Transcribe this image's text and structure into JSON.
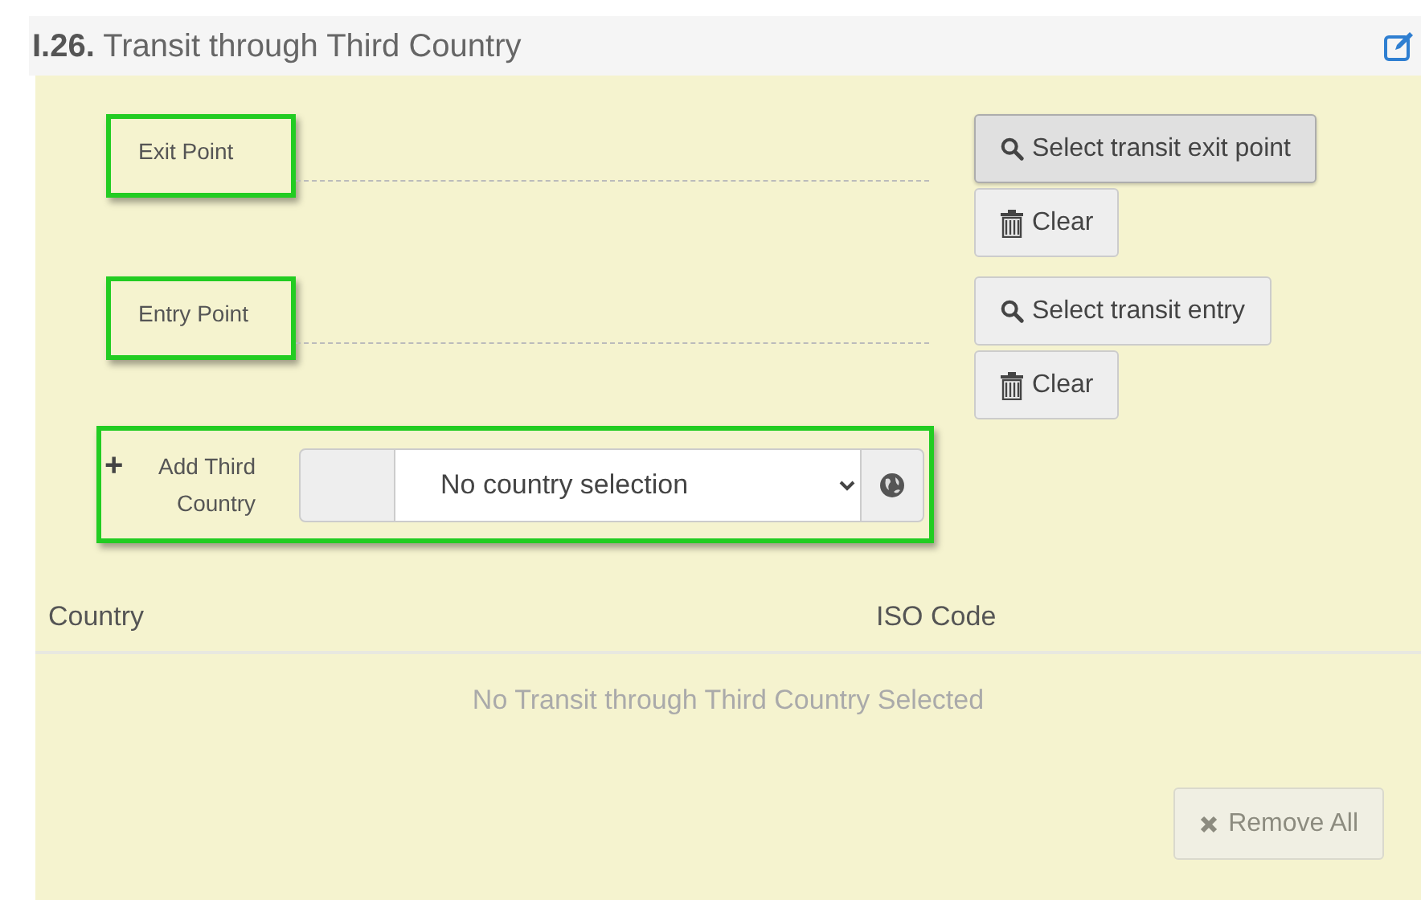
{
  "section": {
    "number": "I.26.",
    "title": "Transit through Third Country"
  },
  "points": [
    {
      "label": "Exit Point",
      "highlighted": true,
      "buttons": [
        {
          "kind": "search",
          "label": "Select transit exit point",
          "hovered": true
        },
        {
          "kind": "clear",
          "label": "Clear",
          "hovered": false
        }
      ]
    },
    {
      "label": "Entry Point",
      "highlighted": true,
      "buttons": [
        {
          "kind": "search",
          "label": "Select transit entry",
          "hovered": false
        },
        {
          "kind": "clear",
          "label": "Clear",
          "hovered": false
        }
      ]
    }
  ],
  "add_country": {
    "icon": "+",
    "label": "Add Third Country",
    "highlighted": true,
    "value": "No country selection"
  },
  "table": {
    "columns": [
      "Country",
      "ISO Code"
    ],
    "empty_message": "No Transit through Third Country Selected"
  },
  "remove_button": {
    "label": "Remove All",
    "disabled": true
  }
}
